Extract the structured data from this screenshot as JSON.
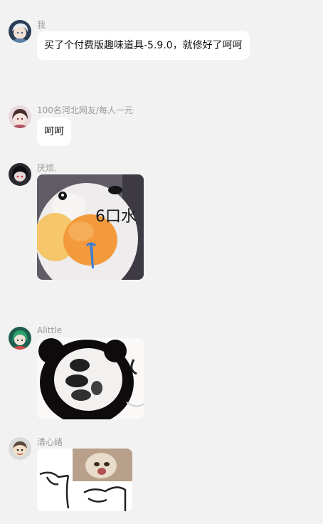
{
  "messages": [
    {
      "sender": "我",
      "type": "text",
      "text": "买了个付费版趣味道具-5.9.0，就修好了呵呵",
      "avatar_icon": "anime-avatar-white-hair"
    },
    {
      "sender": "100名河北网友/每人一元",
      "type": "text",
      "text": "呵呵",
      "avatar_icon": "anime-avatar-girl"
    },
    {
      "sender": "厌烦.",
      "type": "image",
      "sticker": "plush-duck-drooling",
      "sticker_text": "6口水",
      "avatar_icon": "anime-avatar-dark"
    },
    {
      "sender": "Alittle",
      "type": "image",
      "sticker": "panda-face-meme",
      "avatar_icon": "anime-avatar-green"
    },
    {
      "sender": "清心绪",
      "type": "image",
      "sticker": "cat-pointing-meme",
      "avatar_icon": "avatar-cartoon-person"
    }
  ],
  "colors": {
    "background": "#f2f2f2",
    "bubble": "#ffffff",
    "nickname": "#9a9a9a"
  }
}
